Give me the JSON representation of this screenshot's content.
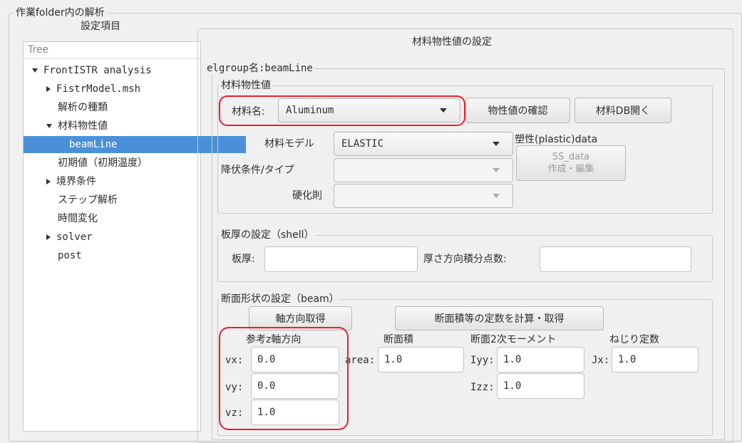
{
  "window_title": "作業folder内の解析",
  "tree": {
    "header": "設定項目",
    "column_title": "Tree",
    "items": [
      {
        "label": "FrontISTR analysis",
        "expander": "down"
      },
      {
        "label": "FistrModel.msh",
        "expander": "right"
      },
      {
        "label": "解析の種類",
        "expander": "none"
      },
      {
        "label": "材料物性値",
        "expander": "down"
      },
      {
        "label": "beamLine",
        "expander": "none",
        "selected": true
      },
      {
        "label": "初期値（初期温度）",
        "expander": "none"
      },
      {
        "label": "境界条件",
        "expander": "right"
      },
      {
        "label": "ステップ解析",
        "expander": "none"
      },
      {
        "label": "時間変化",
        "expander": "none"
      },
      {
        "label": "solver",
        "expander": "right"
      },
      {
        "label": "post",
        "expander": "none"
      }
    ]
  },
  "panel": {
    "title": "材料物性値の設定",
    "elgroup_label": "elgroup名:beamLine",
    "material": {
      "group_title": "材料物性値",
      "name_label": "材料名:",
      "name_value": "Aluminum",
      "check_button": "物性値の確認",
      "open_db_button": "材料DB開く",
      "model_label": "材料モデル",
      "model_value": "ELASTIC",
      "plastic_label": "塑性(plastic)data",
      "ss_button_line1": "SS_data",
      "ss_button_line2": "作成・編集",
      "yield_label": "降伏条件/タイプ",
      "yield_value": "",
      "hardening_label": "硬化則",
      "hardening_value": ""
    },
    "shell": {
      "group_title": "板厚の設定（shell）",
      "thickness_label": "板厚:",
      "thickness_value": "",
      "integ_label": "厚さ方向積分点数:",
      "integ_value": ""
    },
    "beam": {
      "group_title": "断面形状の設定（beam）",
      "axis_button": "軸方向取得",
      "calc_button": "断面積等の定数を計算・取得",
      "ref_axis_header": "参考z軸方向",
      "area_header": "断面積",
      "moment_header": "断面2次モーメント",
      "torsion_header": "ねじり定数",
      "vx_label": "vx:",
      "vx_value": "0.0",
      "vy_label": "vy:",
      "vy_value": "0.0",
      "vz_label": "vz:",
      "vz_value": "1.0",
      "area_label": "area:",
      "area_value": "1.0",
      "iyy_label": "Iyy:",
      "iyy_value": "1.0",
      "izz_label": "Izz:",
      "izz_value": "1.0",
      "jx_label": "Jx:",
      "jx_value": "1.0"
    }
  },
  "colors": {
    "selection": "#4a90d9",
    "highlight": "#e8212e",
    "background": "#f0f0f0"
  }
}
